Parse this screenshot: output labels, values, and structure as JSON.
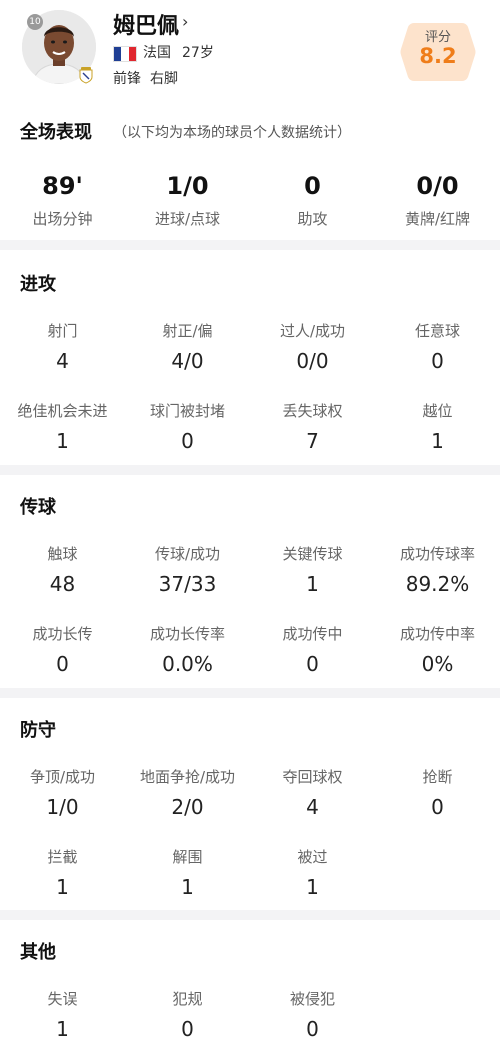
{
  "player": {
    "name": "姆巴佩",
    "chevron": "›",
    "shirt_number": "10",
    "country": "法国",
    "age": "27岁",
    "position": "前锋",
    "foot": "右脚",
    "flag_colors": [
      "#1f3f94",
      "#ffffff",
      "#e0272f"
    ]
  },
  "rating": {
    "label": "评分",
    "value": "8.2",
    "color": "#ef7d1a",
    "bg": "#fde3cc"
  },
  "overall": {
    "title": "全场表现",
    "subtitle": "（以下均为本场的球员个人数据统计）",
    "stats": [
      {
        "value": "89'",
        "label": "出场分钟"
      },
      {
        "value": "1/0",
        "label": "进球/点球"
      },
      {
        "value": "0",
        "label": "助攻"
      },
      {
        "value": "0/0",
        "label": "黄牌/红牌"
      }
    ]
  },
  "attack": {
    "title": "进攻",
    "stats": [
      {
        "label": "射门",
        "value": "4"
      },
      {
        "label": "射正/偏",
        "value": "4/0"
      },
      {
        "label": "过人/成功",
        "value": "0/0"
      },
      {
        "label": "任意球",
        "value": "0"
      },
      {
        "label": "绝佳机会未进",
        "value": "1"
      },
      {
        "label": "球门被封堵",
        "value": "0"
      },
      {
        "label": "丢失球权",
        "value": "7"
      },
      {
        "label": "越位",
        "value": "1"
      }
    ]
  },
  "passing": {
    "title": "传球",
    "stats": [
      {
        "label": "触球",
        "value": "48"
      },
      {
        "label": "传球/成功",
        "value": "37/33"
      },
      {
        "label": "关键传球",
        "value": "1"
      },
      {
        "label": "成功传球率",
        "value": "89.2%"
      },
      {
        "label": "成功长传",
        "value": "0"
      },
      {
        "label": "成功长传率",
        "value": "0.0%"
      },
      {
        "label": "成功传中",
        "value": "0"
      },
      {
        "label": "成功传中率",
        "value": "0%"
      }
    ]
  },
  "defense": {
    "title": "防守",
    "stats": [
      {
        "label": "争顶/成功",
        "value": "1/0"
      },
      {
        "label": "地面争抢/成功",
        "value": "2/0"
      },
      {
        "label": "夺回球权",
        "value": "4"
      },
      {
        "label": "抢断",
        "value": "0"
      },
      {
        "label": "拦截",
        "value": "1"
      },
      {
        "label": "解围",
        "value": "1"
      },
      {
        "label": "被过",
        "value": "1"
      }
    ]
  },
  "other": {
    "title": "其他",
    "stats": [
      {
        "label": "失误",
        "value": "1"
      },
      {
        "label": "犯规",
        "value": "0"
      },
      {
        "label": "被侵犯",
        "value": "0"
      }
    ]
  }
}
